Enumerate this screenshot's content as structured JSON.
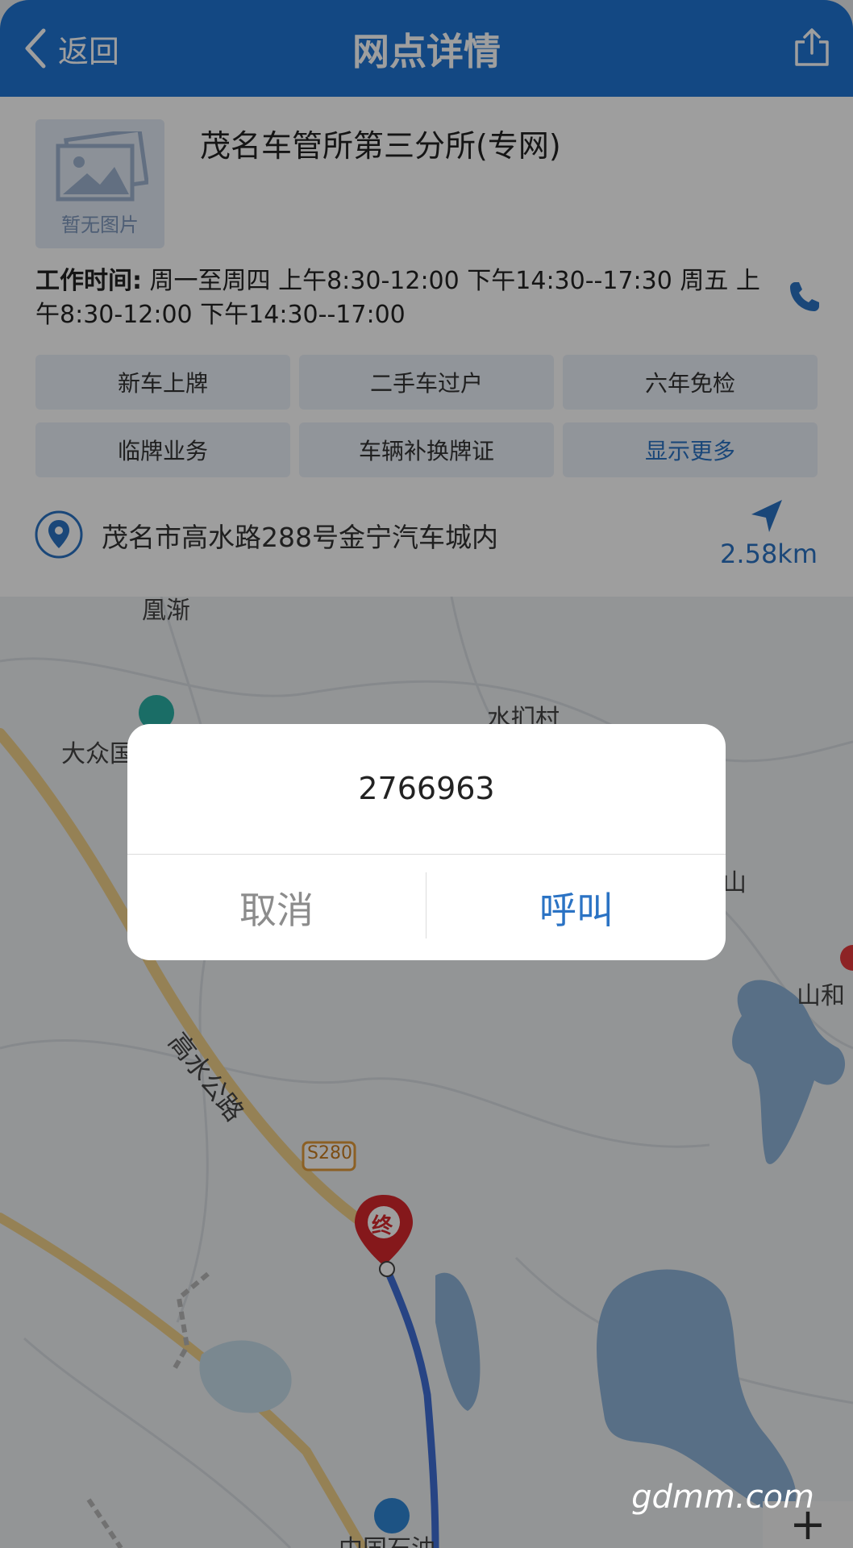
{
  "header": {
    "back_label": "返回",
    "title": "网点详情",
    "icons": {
      "back": "chevron-left-icon",
      "share": "share-icon"
    },
    "color": "#1f74d3"
  },
  "station": {
    "image_placeholder": "暂无图片",
    "name": "茂名车管所第三分所(专网)",
    "hours_label": "工作时间:",
    "hours_text": "周一至周四 上午8:30-12:00 下午14:30--17:30 周五 上午8:30-12:00 下午14:30--17:00",
    "services": [
      "新车上牌",
      "二手车过户",
      "六年免检",
      "临牌业务",
      "车辆补换牌证",
      "显示更多"
    ],
    "address": "茂名市高水路288号金宁汽车城内",
    "distance": "2.58km",
    "accent_color": "#2b73c4"
  },
  "map": {
    "labels": [
      "凰渐",
      "水扪村",
      "大众国",
      "山",
      "山和",
      "S280",
      "高水公路",
      "终",
      "中国石油"
    ]
  },
  "dialog": {
    "number": "2766963",
    "cancel_label": "取消",
    "call_label": "呼叫"
  },
  "watermark": "gdmm.com",
  "zoom_in": "+"
}
